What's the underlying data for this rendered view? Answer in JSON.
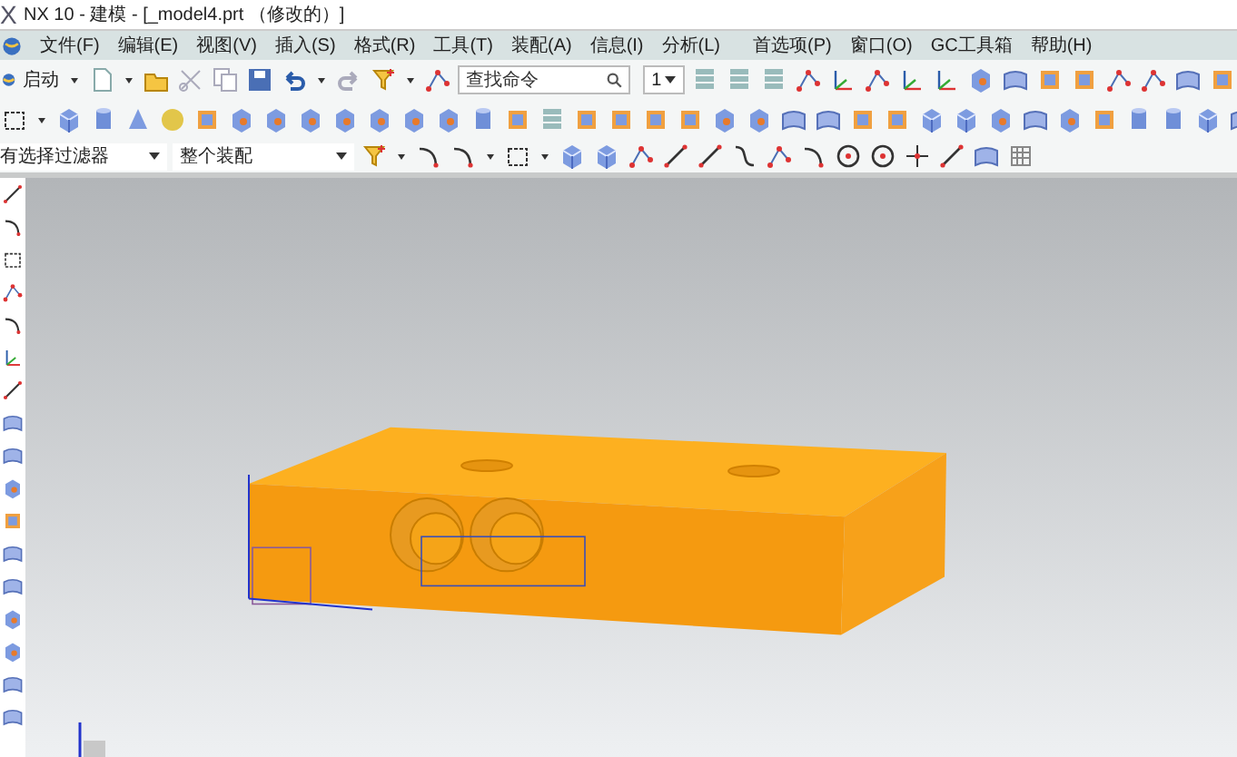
{
  "window": {
    "logo": "X",
    "title": "NX 10 - 建模 - [_model4.prt （修改的）]"
  },
  "menu": [
    "文件(F)",
    "编辑(E)",
    "视图(V)",
    "插入(S)",
    "格式(R)",
    "工具(T)",
    "装配(A)",
    "信息(I)",
    "分析(L)",
    "首选项(P)",
    "窗口(O)",
    "GC工具箱",
    "帮助(H)"
  ],
  "toolbar": {
    "start_label": "启动",
    "search": {
      "placeholder": "查找命令"
    },
    "layer": {
      "value": "1"
    }
  },
  "selection_bar": {
    "filter": {
      "value": "有选择过滤器"
    },
    "scope": {
      "value": "整个装配"
    }
  }
}
